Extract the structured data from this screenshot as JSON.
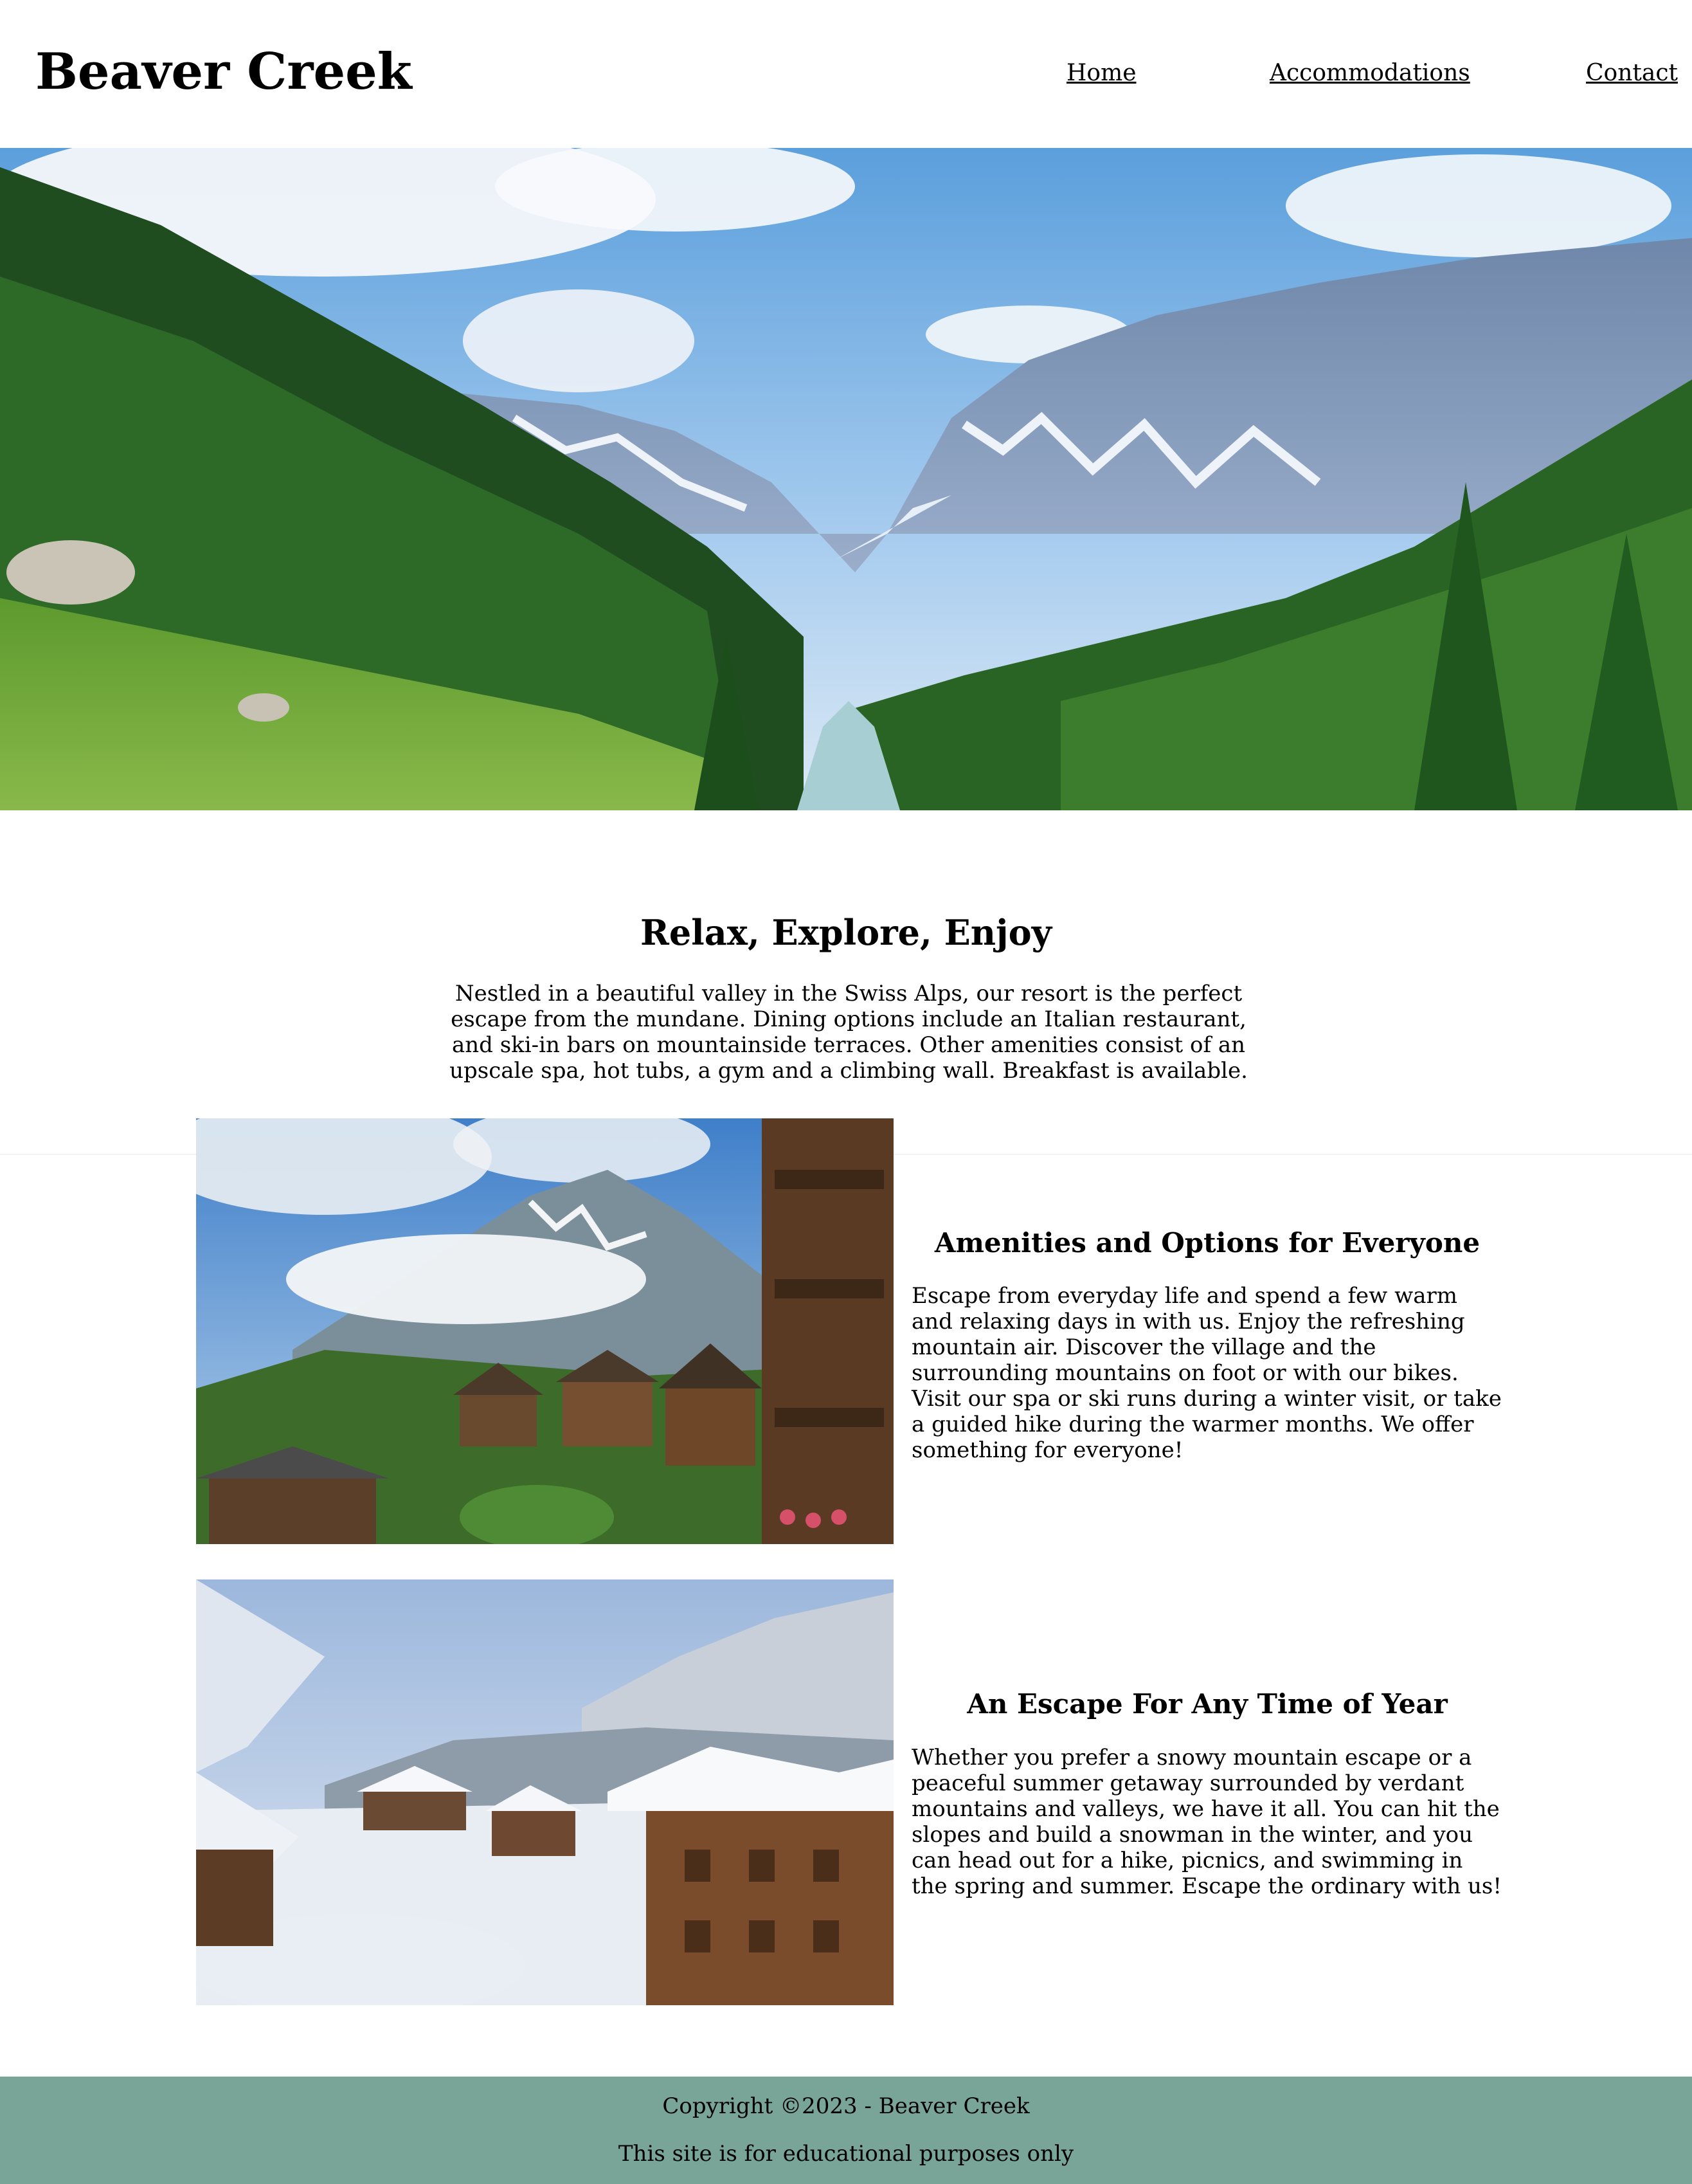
{
  "header": {
    "site_title": "Beaver Creek",
    "nav": [
      {
        "label": "Home"
      },
      {
        "label": "Accommodations"
      },
      {
        "label": "Contact"
      }
    ]
  },
  "intro": {
    "title": "Relax, Explore, Enjoy",
    "text": "Nestled in a beautiful valley in the Swiss Alps, our resort is the perfect escape from the mundane. Dining options include an Italian restaurant, and ski-in bars on mountainside terraces. Other amenities consist of an upscale spa, hot tubs, a gym and a climbing wall. Breakfast is available."
  },
  "features": [
    {
      "title": "Amenities and Options for Everyone",
      "text": "Escape from everyday life and spend a few warm and relaxing days in with us. Enjoy the refreshing mountain air. Discover the village and the surrounding mountains on foot or with our bikes. Visit our spa or ski runs during a winter visit, or take a guided hike during the warmer months. We offer something for everyone!"
    },
    {
      "title": "An Escape For Any Time of Year",
      "text": "Whether you prefer a snowy mountain escape or a peaceful summer getaway surrounded by verdant mountains and valleys, we have it all. You can hit the slopes and build a snowman in the winter, and you can head out for a hike, picnics, and swimming in the spring and summer. Escape the ordinary with us!"
    }
  ],
  "footer": {
    "copyright": "Copyright ©2023 - Beaver Creek",
    "note": "This site is for educational purposes only"
  },
  "colors": {
    "footer_bg": "#78a597",
    "text": "#000000",
    "background": "#ffffff"
  }
}
